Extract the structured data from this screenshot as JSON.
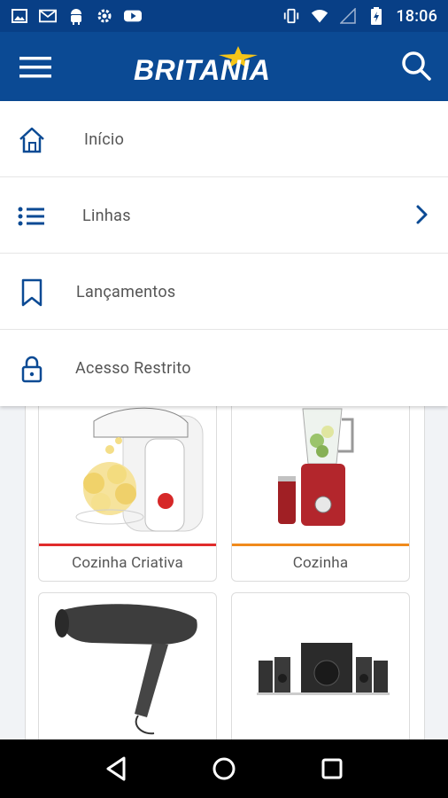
{
  "status_bar": {
    "time": "18:06",
    "left_icons": [
      "image-icon",
      "gmail-icon",
      "android-icon",
      "settings-icon",
      "youtube-icon"
    ],
    "right_icons": [
      "vibrate-icon",
      "wifi-icon",
      "signal-icon",
      "battery-icon"
    ]
  },
  "app_bar": {
    "brand": "BRITANIA",
    "menu_icon": "hamburger-icon",
    "search_icon": "search-icon",
    "colors": {
      "background": "#0b4a94",
      "status": "#083f86",
      "star": "#f5c518"
    }
  },
  "menu": {
    "items": [
      {
        "label": "Início",
        "icon": "home-icon"
      },
      {
        "label": "Linhas",
        "icon": "list-icon",
        "has_submenu": true
      },
      {
        "label": "Lançamentos",
        "icon": "bookmark-icon"
      },
      {
        "label": "Acesso Restrito",
        "icon": "lock-icon"
      }
    ],
    "accent_color": "#0b4a94"
  },
  "categories": [
    {
      "title": "Cozinha Criativa",
      "image": "popcorn-maker-image",
      "accent": "#e02b2b"
    },
    {
      "title": "Cozinha",
      "image": "blender-image",
      "accent": "#f08a1c"
    },
    {
      "title": "",
      "image": "hair-dryer-image",
      "accent": ""
    },
    {
      "title": "",
      "image": "speaker-system-image",
      "accent": ""
    }
  ],
  "nav_bar": {
    "buttons": [
      "back-icon",
      "home-circle-icon",
      "recents-icon"
    ]
  }
}
